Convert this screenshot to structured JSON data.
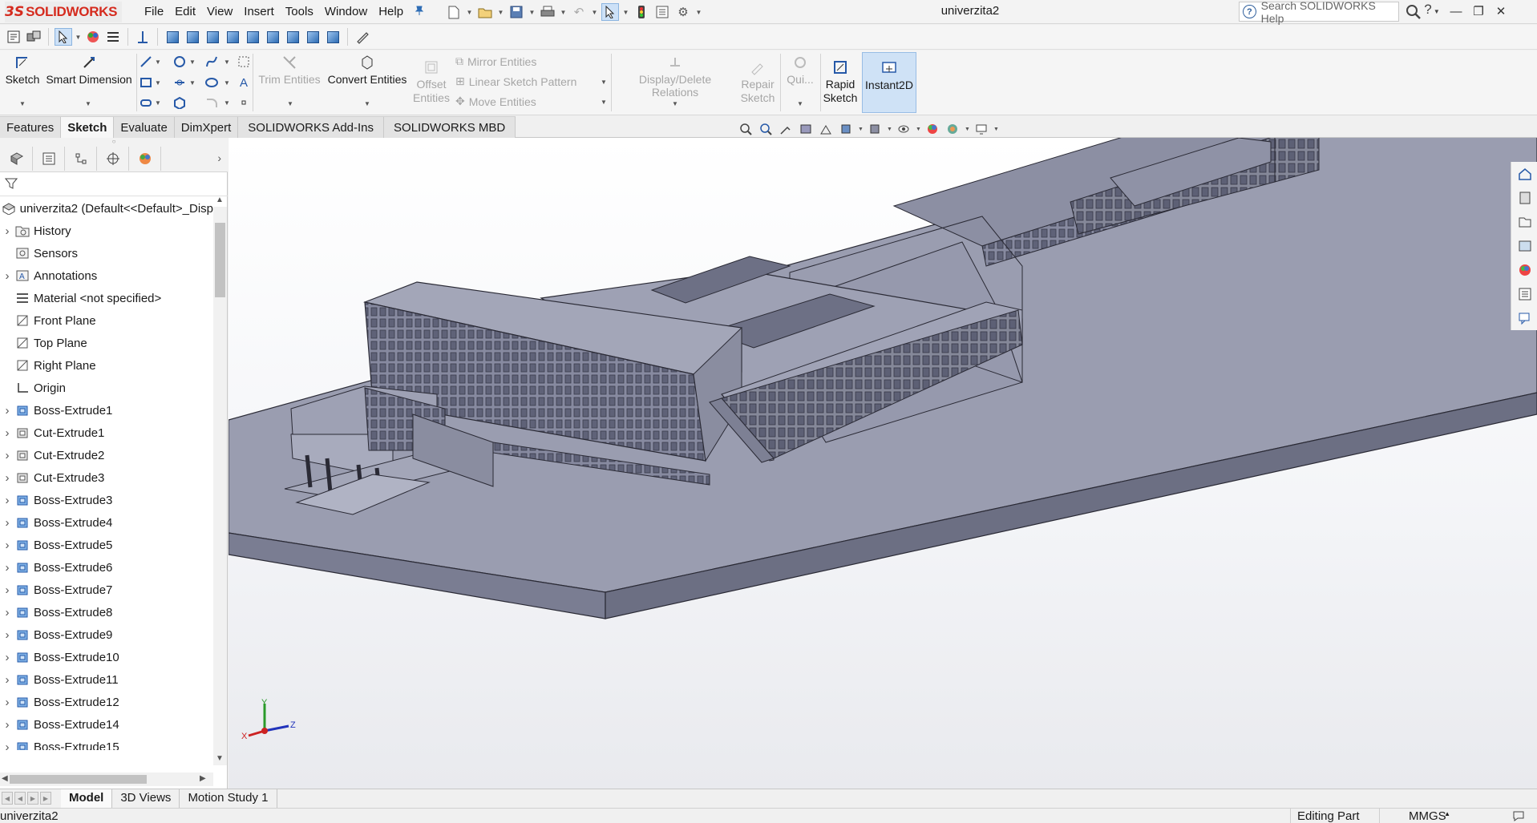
{
  "app": {
    "brand": "SOLIDWORKS",
    "brand_prefix": "3S",
    "doc_title": "univerzita2",
    "menu": [
      "File",
      "Edit",
      "View",
      "Insert",
      "Tools",
      "Window",
      "Help"
    ],
    "search_placeholder": "Search SOLIDWORKS Help",
    "help_label": "?"
  },
  "command_manager": {
    "sketch": "Sketch",
    "smart_dimension": "Smart Dimension",
    "trim": "Trim Entities",
    "convert": "Convert Entities",
    "offset_l1": "Offset",
    "offset_l2": "Entities",
    "mirror": "Mirror Entities",
    "linear_pattern": "Linear Sketch Pattern",
    "move": "Move Entities",
    "display_delete": "Display/Delete Relations",
    "repair_l1": "Repair",
    "repair_l2": "Sketch",
    "quick": "Qui...",
    "rapid_l1": "Rapid",
    "rapid_l2": "Sketch",
    "instant2d": "Instant2D"
  },
  "tabs": [
    "Features",
    "Sketch",
    "Evaluate",
    "DimXpert",
    "SOLIDWORKS Add-Ins",
    "SOLIDWORKS MBD"
  ],
  "active_tab": "Sketch",
  "feature_tree": {
    "root": "univerzita2  (Default<<Default>_Disp",
    "items": [
      {
        "label": "History",
        "icon": "history-folder-icon",
        "expandable": true
      },
      {
        "label": "Sensors",
        "icon": "sensors-icon",
        "expandable": false
      },
      {
        "label": "Annotations",
        "icon": "annotations-icon",
        "expandable": true
      },
      {
        "label": "Material <not specified>",
        "icon": "material-icon",
        "expandable": false
      },
      {
        "label": "Front Plane",
        "icon": "plane-icon",
        "expandable": false
      },
      {
        "label": "Top Plane",
        "icon": "plane-icon",
        "expandable": false
      },
      {
        "label": "Right Plane",
        "icon": "plane-icon",
        "expandable": false
      },
      {
        "label": "Origin",
        "icon": "origin-icon",
        "expandable": false
      },
      {
        "label": "Boss-Extrude1",
        "icon": "boss-extrude-icon",
        "expandable": true
      },
      {
        "label": "Cut-Extrude1",
        "icon": "cut-extrude-icon",
        "expandable": true
      },
      {
        "label": "Cut-Extrude2",
        "icon": "cut-extrude-icon",
        "expandable": true
      },
      {
        "label": "Cut-Extrude3",
        "icon": "cut-extrude-icon",
        "expandable": true
      },
      {
        "label": "Boss-Extrude3",
        "icon": "boss-extrude-icon",
        "expandable": true
      },
      {
        "label": "Boss-Extrude4",
        "icon": "boss-extrude-icon",
        "expandable": true
      },
      {
        "label": "Boss-Extrude5",
        "icon": "boss-extrude-icon",
        "expandable": true
      },
      {
        "label": "Boss-Extrude6",
        "icon": "boss-extrude-icon",
        "expandable": true
      },
      {
        "label": "Boss-Extrude7",
        "icon": "boss-extrude-icon",
        "expandable": true
      },
      {
        "label": "Boss-Extrude8",
        "icon": "boss-extrude-icon",
        "expandable": true
      },
      {
        "label": "Boss-Extrude9",
        "icon": "boss-extrude-icon",
        "expandable": true
      },
      {
        "label": "Boss-Extrude10",
        "icon": "boss-extrude-icon",
        "expandable": true
      },
      {
        "label": "Boss-Extrude11",
        "icon": "boss-extrude-icon",
        "expandable": true
      },
      {
        "label": "Boss-Extrude12",
        "icon": "boss-extrude-icon",
        "expandable": true
      },
      {
        "label": "Boss-Extrude14",
        "icon": "boss-extrude-icon",
        "expandable": true
      },
      {
        "label": "Boss-Extrude15",
        "icon": "boss-extrude-icon",
        "expandable": true
      }
    ]
  },
  "triad": {
    "x": "X",
    "y": "Y",
    "z": "Z"
  },
  "bottom_tabs": [
    "Model",
    "3D Views",
    "Motion Study 1"
  ],
  "status": {
    "left": "univerzita2",
    "mode": "Editing Part",
    "units": "MMGS"
  },
  "colors": {
    "brand_red": "#d52b1e",
    "model_face": "#9497ab",
    "accent_blue": "#2659a8"
  }
}
